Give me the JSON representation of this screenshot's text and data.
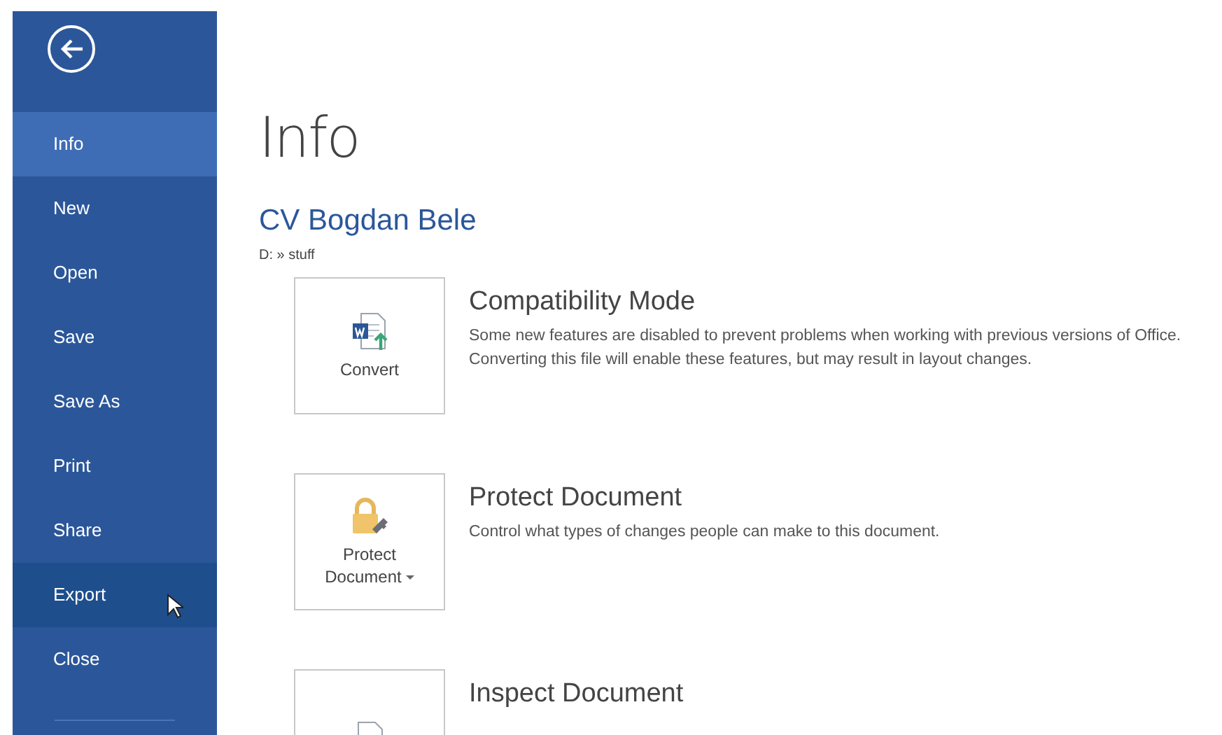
{
  "sidebar": {
    "items": [
      {
        "label": "Info",
        "selected": true,
        "hovered": false
      },
      {
        "label": "New",
        "selected": false,
        "hovered": false
      },
      {
        "label": "Open",
        "selected": false,
        "hovered": false
      },
      {
        "label": "Save",
        "selected": false,
        "hovered": false
      },
      {
        "label": "Save As",
        "selected": false,
        "hovered": false
      },
      {
        "label": "Print",
        "selected": false,
        "hovered": false
      },
      {
        "label": "Share",
        "selected": false,
        "hovered": false
      },
      {
        "label": "Export",
        "selected": false,
        "hovered": true
      },
      {
        "label": "Close",
        "selected": false,
        "hovered": false
      }
    ]
  },
  "page": {
    "title": "Info",
    "document_name": "CV Bogdan Bele",
    "path": "D: » stuff",
    "sections": [
      {
        "kind": "convert",
        "button": "Convert",
        "title": "Compatibility Mode",
        "description": "Some new features are disabled to prevent problems when working with previous versions of Office. Converting this file will enable these features, but may result in layout changes."
      },
      {
        "kind": "protect",
        "button": "Protect Document",
        "title": "Protect Document",
        "description": "Control what types of changes people can make to this document."
      },
      {
        "kind": "inspect",
        "title": "Inspect Document"
      }
    ]
  }
}
